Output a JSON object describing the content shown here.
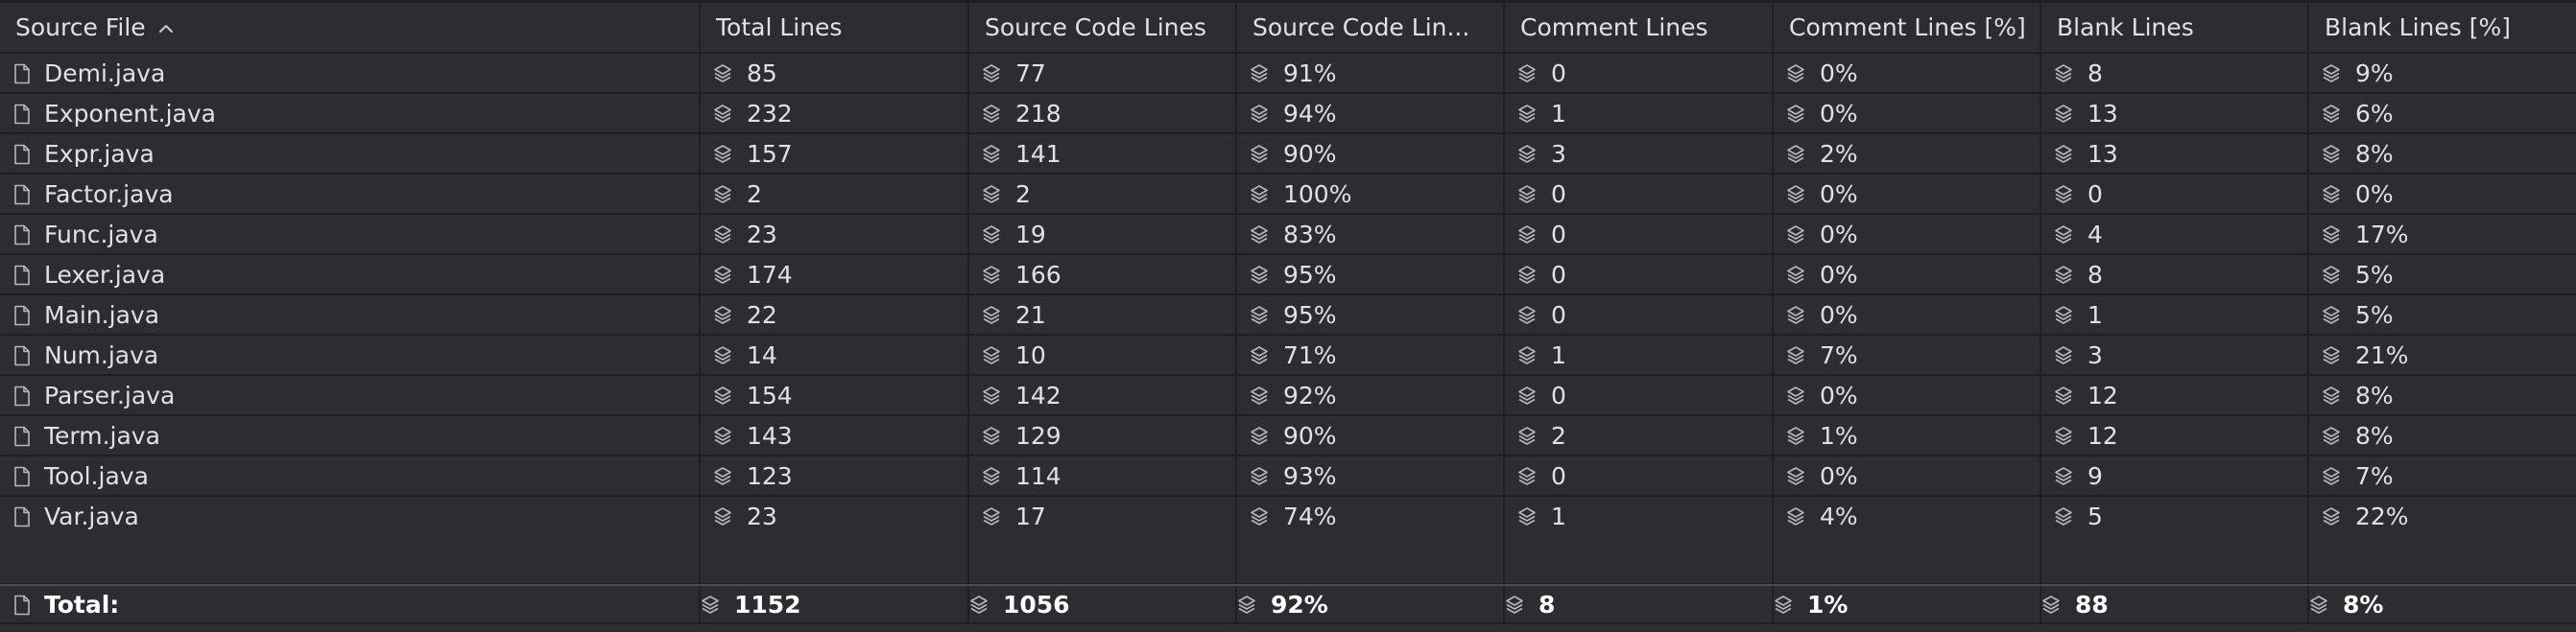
{
  "columns": [
    "Source File",
    "Total Lines",
    "Source Code Lines",
    "Source Code Lin...",
    "Comment Lines",
    "Comment Lines [%]",
    "Blank Lines",
    "Blank Lines [%]"
  ],
  "sort": {
    "column": "Source File",
    "direction": "ascending",
    "icon": "chevron-up-icon"
  },
  "rows": [
    {
      "file": "Demi.java",
      "total": "85",
      "code": "77",
      "code_pct": "91%",
      "comment": "0",
      "comment_pct": "0%",
      "blank": "8",
      "blank_pct": "9%"
    },
    {
      "file": "Exponent.java",
      "total": "232",
      "code": "218",
      "code_pct": "94%",
      "comment": "1",
      "comment_pct": "0%",
      "blank": "13",
      "blank_pct": "6%"
    },
    {
      "file": "Expr.java",
      "total": "157",
      "code": "141",
      "code_pct": "90%",
      "comment": "3",
      "comment_pct": "2%",
      "blank": "13",
      "blank_pct": "8%"
    },
    {
      "file": "Factor.java",
      "total": "2",
      "code": "2",
      "code_pct": "100%",
      "comment": "0",
      "comment_pct": "0%",
      "blank": "0",
      "blank_pct": "0%"
    },
    {
      "file": "Func.java",
      "total": "23",
      "code": "19",
      "code_pct": "83%",
      "comment": "0",
      "comment_pct": "0%",
      "blank": "4",
      "blank_pct": "17%"
    },
    {
      "file": "Lexer.java",
      "total": "174",
      "code": "166",
      "code_pct": "95%",
      "comment": "0",
      "comment_pct": "0%",
      "blank": "8",
      "blank_pct": "5%"
    },
    {
      "file": "Main.java",
      "total": "22",
      "code": "21",
      "code_pct": "95%",
      "comment": "0",
      "comment_pct": "0%",
      "blank": "1",
      "blank_pct": "5%"
    },
    {
      "file": "Num.java",
      "total": "14",
      "code": "10",
      "code_pct": "71%",
      "comment": "1",
      "comment_pct": "7%",
      "blank": "3",
      "blank_pct": "21%"
    },
    {
      "file": "Parser.java",
      "total": "154",
      "code": "142",
      "code_pct": "92%",
      "comment": "0",
      "comment_pct": "0%",
      "blank": "12",
      "blank_pct": "8%"
    },
    {
      "file": "Term.java",
      "total": "143",
      "code": "129",
      "code_pct": "90%",
      "comment": "2",
      "comment_pct": "1%",
      "blank": "12",
      "blank_pct": "8%"
    },
    {
      "file": "Tool.java",
      "total": "123",
      "code": "114",
      "code_pct": "93%",
      "comment": "0",
      "comment_pct": "0%",
      "blank": "9",
      "blank_pct": "7%"
    },
    {
      "file": "Var.java",
      "total": "23",
      "code": "17",
      "code_pct": "74%",
      "comment": "1",
      "comment_pct": "4%",
      "blank": "5",
      "blank_pct": "22%"
    }
  ],
  "total": {
    "file": "Total:",
    "total": "1152",
    "code": "1056",
    "code_pct": "92%",
    "comment": "8",
    "comment_pct": "1%",
    "blank": "88",
    "blank_pct": "8%"
  },
  "icons": {
    "file": "file-icon",
    "metric": "layers-icon"
  },
  "colors": {
    "background": "#2b2d30",
    "grid": "#1e1f22",
    "text": "#dfe1e5",
    "icon": "#b4b8bf"
  }
}
